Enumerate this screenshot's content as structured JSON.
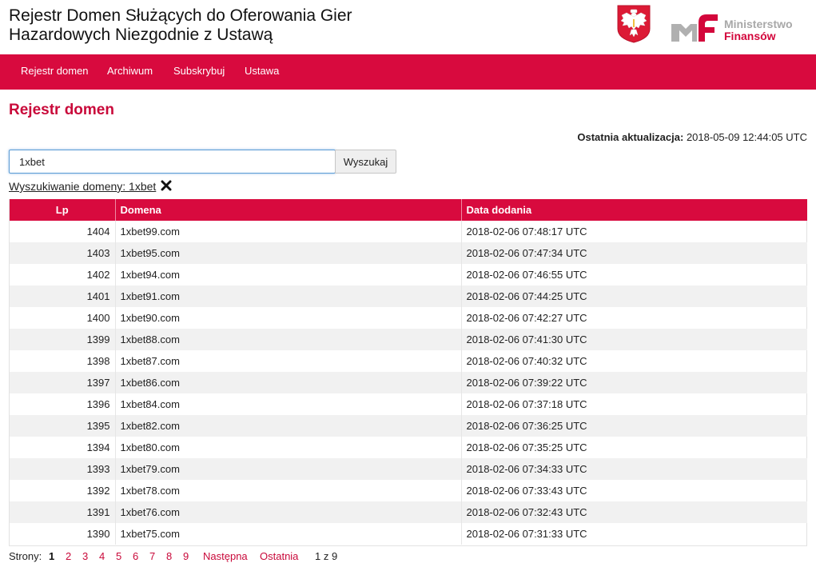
{
  "header": {
    "title_line1": "Rejestr Domen Służących do Oferowania Gier",
    "title_line2": "Hazardowych Niezgodnie z Ustawą",
    "ministry_line1": "Ministerstwo",
    "ministry_line2": "Finansów",
    "emblem_icon": "polish-eagle-emblem-icon",
    "logo_icon": "mf-logo-icon"
  },
  "nav": {
    "items": [
      "Rejestr domen",
      "Archiwum",
      "Subskrybuj",
      "Ustawa"
    ]
  },
  "page": {
    "heading": "Rejestr domen",
    "last_update_label": "Ostatnia aktualizacja:",
    "last_update_value": "2018-05-09 12:44:05 UTC"
  },
  "search": {
    "value": "1xbet",
    "button_label": "Wyszukaj",
    "info_text": "Wyszukiwanie domeny: 1xbet",
    "clear_icon": "close-x-icon"
  },
  "table": {
    "headers": [
      "Lp",
      "Domena",
      "Data dodania"
    ],
    "rows": [
      [
        "1404",
        "1xbet99.com",
        "2018-02-06 07:48:17 UTC"
      ],
      [
        "1403",
        "1xbet95.com",
        "2018-02-06 07:47:34 UTC"
      ],
      [
        "1402",
        "1xbet94.com",
        "2018-02-06 07:46:55 UTC"
      ],
      [
        "1401",
        "1xbet91.com",
        "2018-02-06 07:44:25 UTC"
      ],
      [
        "1400",
        "1xbet90.com",
        "2018-02-06 07:42:27 UTC"
      ],
      [
        "1399",
        "1xbet88.com",
        "2018-02-06 07:41:30 UTC"
      ],
      [
        "1398",
        "1xbet87.com",
        "2018-02-06 07:40:32 UTC"
      ],
      [
        "1397",
        "1xbet86.com",
        "2018-02-06 07:39:22 UTC"
      ],
      [
        "1396",
        "1xbet84.com",
        "2018-02-06 07:37:18 UTC"
      ],
      [
        "1395",
        "1xbet82.com",
        "2018-02-06 07:36:25 UTC"
      ],
      [
        "1394",
        "1xbet80.com",
        "2018-02-06 07:35:25 UTC"
      ],
      [
        "1393",
        "1xbet79.com",
        "2018-02-06 07:34:33 UTC"
      ],
      [
        "1392",
        "1xbet78.com",
        "2018-02-06 07:33:43 UTC"
      ],
      [
        "1391",
        "1xbet76.com",
        "2018-02-06 07:32:43 UTC"
      ],
      [
        "1390",
        "1xbet75.com",
        "2018-02-06 07:31:33 UTC"
      ]
    ]
  },
  "pagination": {
    "label": "Strony:",
    "current": "1",
    "pages": [
      "2",
      "3",
      "4",
      "5",
      "6",
      "7",
      "8",
      "9"
    ],
    "next_label": "Następna",
    "last_label": "Ostatnia",
    "summary": "1 z 9"
  },
  "colors": {
    "brand_red": "#d80a3e",
    "heading_red": "#c9093a",
    "row_alt": "#f1f1f1"
  }
}
